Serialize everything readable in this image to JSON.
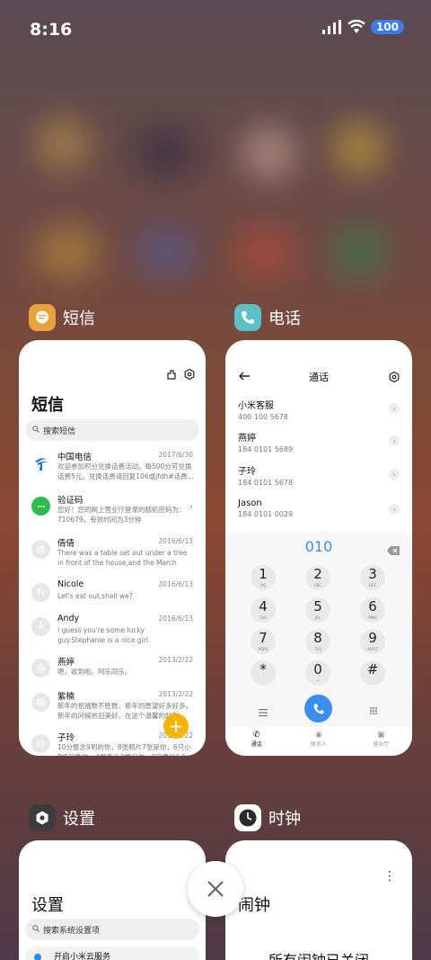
{
  "status": {
    "time": "8:16",
    "battery": "100"
  },
  "colors": {
    "sms_icon": "#e9a23b",
    "phone_icon": "#5cc1c7",
    "settings_icon": "#3c3c3c",
    "clock_icon": "#2b2b2b",
    "accent": "#3a8ef0",
    "fab": "#f5b400"
  },
  "apps": {
    "sms": {
      "label": "短信",
      "icon": "message-icon"
    },
    "phone": {
      "label": "电话",
      "icon": "phone-icon"
    },
    "settings": {
      "label": "设置",
      "icon": "gear-icon"
    },
    "clock": {
      "label": "时钟",
      "icon": "clock-icon"
    }
  },
  "sms_card": {
    "title": "短信",
    "search_placeholder": "搜索短信",
    "messages": [
      {
        "avatar": "",
        "name": "中国电信",
        "date": "2017/6/30",
        "body": "欢迎参加积分兑换话费活动，每500分可兑换话费5元。兑换话费请回复106或jfdh#话费..."
      },
      {
        "avatar": "",
        "name": "验证码",
        "date": "",
        "body": "您好！您的网上营业厅登录的随机密码为：710679。有效时间为3分钟"
      },
      {
        "avatar": "倩",
        "name": "倩倩",
        "date": "2016/6/13",
        "body": "There was a table set out under a tree in front of the house,and the March Hare an..."
      },
      {
        "avatar": "N",
        "name": "Nicole",
        "date": "2016/6/13",
        "body": "Let's eat out,shall we?"
      },
      {
        "avatar": "A",
        "name": "Andy",
        "date": "2016/6/13",
        "body": "I guess you're some lucky guy.Stephanie is a nice girl."
      },
      {
        "avatar": "燕",
        "name": "燕婷",
        "date": "2013/2/22",
        "body": "嗯，收到啦。阿乐同乐。"
      },
      {
        "avatar": "楠",
        "name": "紫楠",
        "date": "2013/2/22",
        "body": "新年的祝福数不胜数，新年的愿望好多好多，新年的问候依旧美好，在这个温馨的时刻..."
      },
      {
        "avatar": "玲",
        "name": "子玲",
        "date": "2013/2/22",
        "body": "10分整念9到的你，8张照片7张是你，6只小狗5只像你，4根骨头3根归你，2只要给1个"
      }
    ]
  },
  "phone_card": {
    "title": "通话",
    "contacts": [
      {
        "name": "小米客服",
        "number": "400 100 5678"
      },
      {
        "name": "燕婷",
        "number": "184 0101 5689"
      },
      {
        "name": "子玲",
        "number": "184 0101 5678"
      },
      {
        "name": "Jason",
        "number": "184 0101 0029"
      }
    ],
    "dial_number": "010",
    "keys": [
      {
        "d": "1",
        "l": "QQ"
      },
      {
        "d": "2",
        "l": "ABC"
      },
      {
        "d": "3",
        "l": "DEF"
      },
      {
        "d": "4",
        "l": "GHI"
      },
      {
        "d": "5",
        "l": "JKL"
      },
      {
        "d": "6",
        "l": "MNO"
      },
      {
        "d": "7",
        "l": "PQRS"
      },
      {
        "d": "8",
        "l": "TUV"
      },
      {
        "d": "9",
        "l": "WXYZ"
      },
      {
        "d": "*",
        "l": ""
      },
      {
        "d": "0",
        "l": "+"
      },
      {
        "d": "#",
        "l": ""
      }
    ],
    "tabs": [
      "通话",
      "联系人",
      "营业厅"
    ]
  },
  "settings_card": {
    "title": "设置",
    "search_placeholder": "搜索系统设置项",
    "first_item": "开启小米云服务"
  },
  "clock_card": {
    "title": "闹钟",
    "message": "所有闹钟已关闭"
  }
}
